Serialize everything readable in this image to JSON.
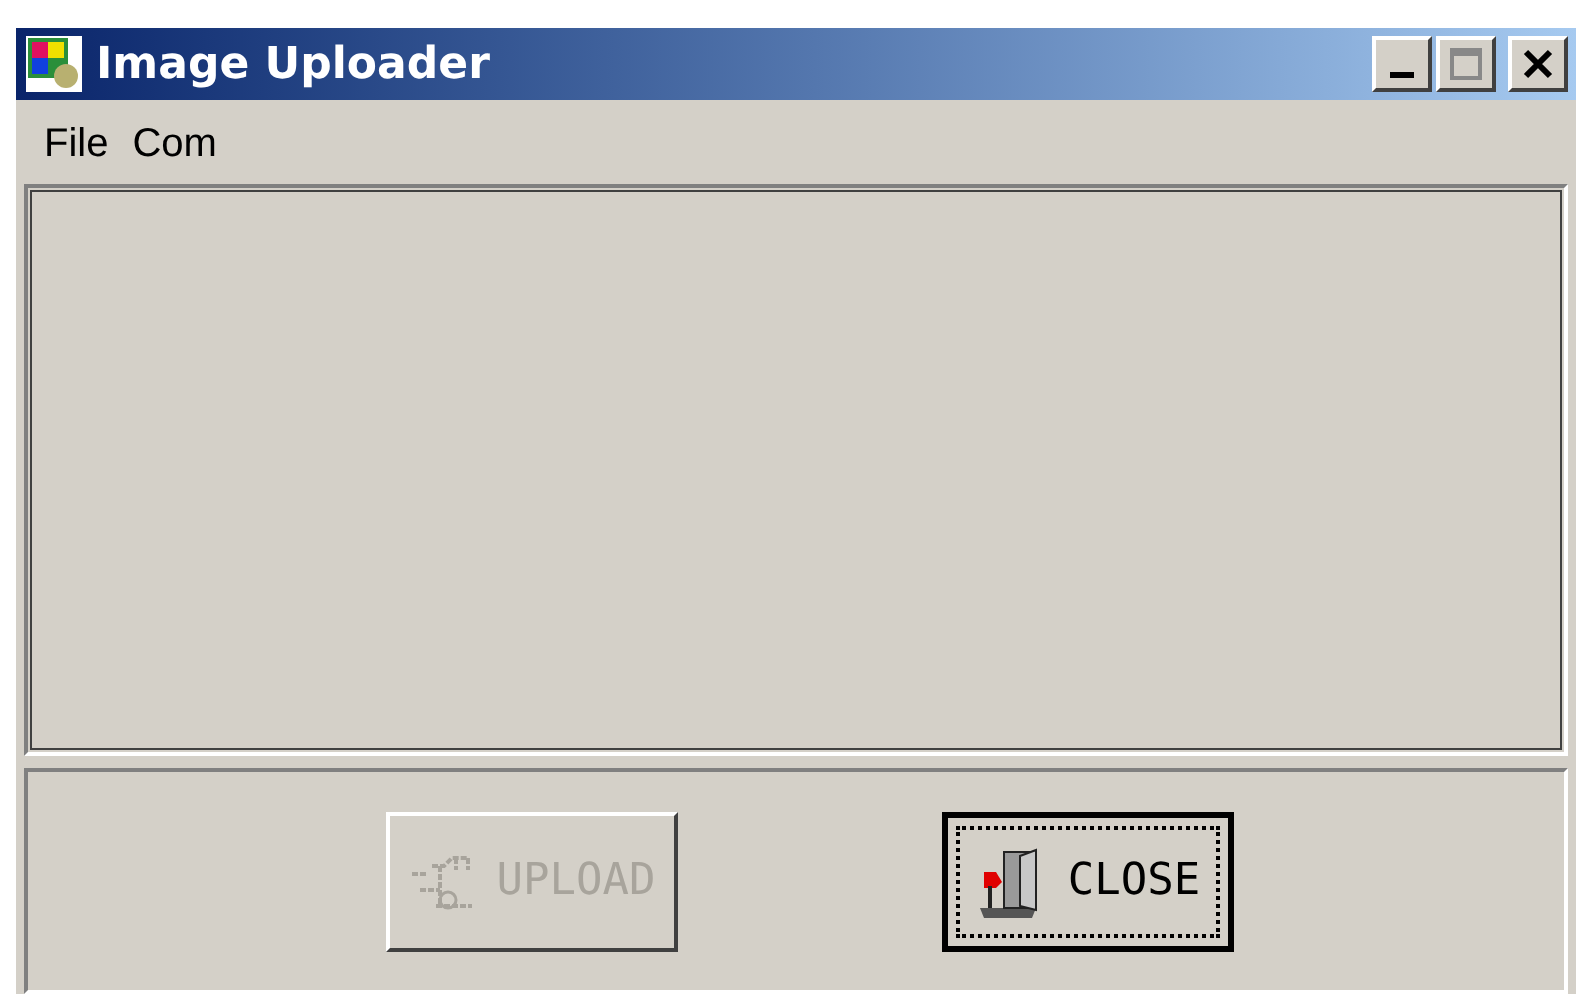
{
  "window": {
    "title": "Image Uploader"
  },
  "menu": [
    "File",
    "Com"
  ],
  "buttons": [
    {
      "label": "UPLOAD",
      "kind": "upload",
      "disabled": true,
      "focused": false
    },
    {
      "label": "CLOSE",
      "kind": "close",
      "disabled": false,
      "focused": true
    }
  ]
}
